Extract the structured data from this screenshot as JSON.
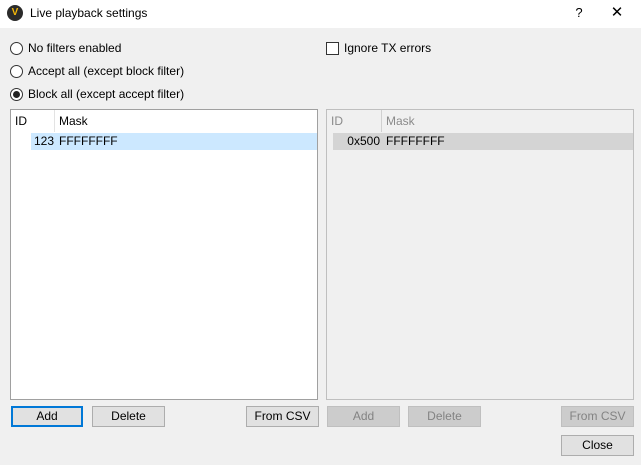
{
  "window": {
    "title": "Live playback settings",
    "app_icon_letter": "V",
    "help_label": "?",
    "close_label": "✕"
  },
  "filter_mode": {
    "options": [
      {
        "label": "No filters enabled",
        "checked": false
      },
      {
        "label": "Accept all (except block filter)",
        "checked": false
      },
      {
        "label": "Block all (except accept filter)",
        "checked": true
      }
    ]
  },
  "ignore_tx": {
    "label": "Ignore TX errors",
    "checked": false
  },
  "accept_filter": {
    "columns": [
      "ID",
      "Mask"
    ],
    "rows": [
      {
        "id": "123",
        "mask": "FFFFFFFF"
      }
    ],
    "buttons": {
      "add": "Add",
      "delete": "Delete",
      "from_csv": "From CSV"
    }
  },
  "block_filter": {
    "enabled": false,
    "columns": [
      "ID",
      "Mask"
    ],
    "rows": [
      {
        "id": "0x500",
        "mask": "FFFFFFFF"
      }
    ],
    "buttons": {
      "add": "Add",
      "delete": "Delete",
      "from_csv": "From CSV"
    }
  },
  "footer": {
    "close": "Close"
  },
  "colors": {
    "selection": "#cce8ff",
    "focus_border": "#0078d7",
    "icon_ring": "#f5b90a"
  }
}
